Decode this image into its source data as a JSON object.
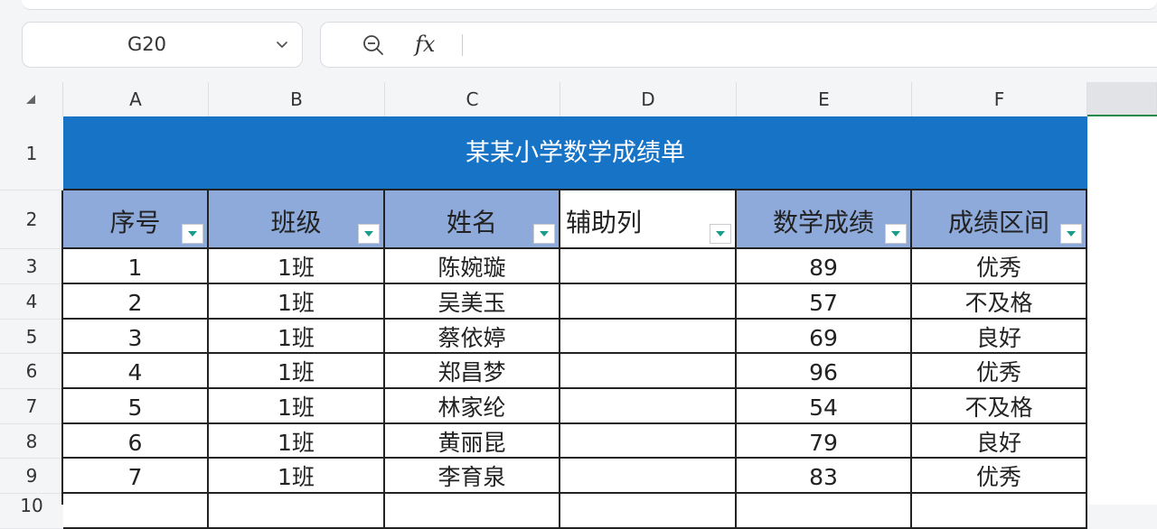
{
  "name_box": {
    "ref": "G20"
  },
  "formula_bar": {
    "fx_label": "fx",
    "content": ""
  },
  "columns": [
    "A",
    "B",
    "C",
    "D",
    "E",
    "F",
    ""
  ],
  "rows": [
    "1",
    "2",
    "3",
    "4",
    "5",
    "6",
    "7",
    "8",
    "9",
    "10"
  ],
  "sheet": {
    "title": "某某小学数学成绩单",
    "headers": [
      "序号",
      "班级",
      "姓名",
      "辅助列",
      "数学成绩",
      "成绩区间"
    ],
    "data": [
      [
        "1",
        "1班",
        "陈婉璇",
        "",
        "89",
        "优秀"
      ],
      [
        "2",
        "1班",
        "吴美玉",
        "",
        "57",
        "不及格"
      ],
      [
        "3",
        "1班",
        "蔡依婷",
        "",
        "69",
        "良好"
      ],
      [
        "4",
        "1班",
        "郑昌梦",
        "",
        "96",
        "优秀"
      ],
      [
        "5",
        "1班",
        "林家纶",
        "",
        "54",
        "不及格"
      ],
      [
        "6",
        "1班",
        "黄丽昆",
        "",
        "79",
        "良好"
      ],
      [
        "7",
        "1班",
        "李育泉",
        "",
        "83",
        "优秀"
      ],
      [
        "",
        "",
        "",
        "",
        "",
        ""
      ]
    ]
  },
  "colors": {
    "title_bg": "#1673c6",
    "header_bg": "#8eaadb",
    "filter_arrow": "#1a9c8a"
  }
}
